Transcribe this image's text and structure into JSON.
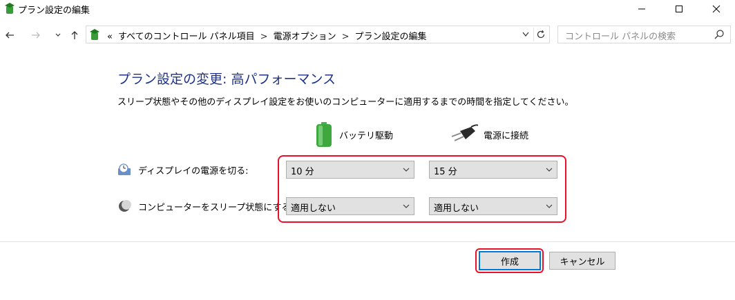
{
  "window": {
    "title": "プラン設定の編集",
    "icon": "power-plan-icon"
  },
  "address_bar": {
    "crumbs": [
      "すべてのコントロール パネル項目",
      "電源オプション",
      "プラン設定の編集"
    ],
    "overflow": "«",
    "separator": ">"
  },
  "search": {
    "placeholder": "コントロール パネルの検索"
  },
  "main": {
    "heading": "プラン設定の変更: 高パフォーマンス",
    "description": "スリープ状態やその他のディスプレイ設定をお使いのコンピューターに適用するまでの時間を指定してください。",
    "columns": [
      {
        "label": "バッテリ駆動",
        "icon": "battery-icon"
      },
      {
        "label": "電源に接続",
        "icon": "power-plug-icon"
      }
    ],
    "rows": [
      {
        "label": "ディスプレイの電源を切る:",
        "icon": "display-clock-icon",
        "battery": "10 分",
        "plugged": "15 分"
      },
      {
        "label": "コンピューターをスリープ状態にする:",
        "icon": "sleep-moon-icon",
        "battery": "適用しない",
        "plugged": "適用しない"
      }
    ]
  },
  "footer": {
    "save_label": "作成",
    "cancel_label": "キャンセル"
  },
  "colors": {
    "heading": "#1e3287",
    "highlight": "#e8102a",
    "focus": "#0078d7"
  }
}
